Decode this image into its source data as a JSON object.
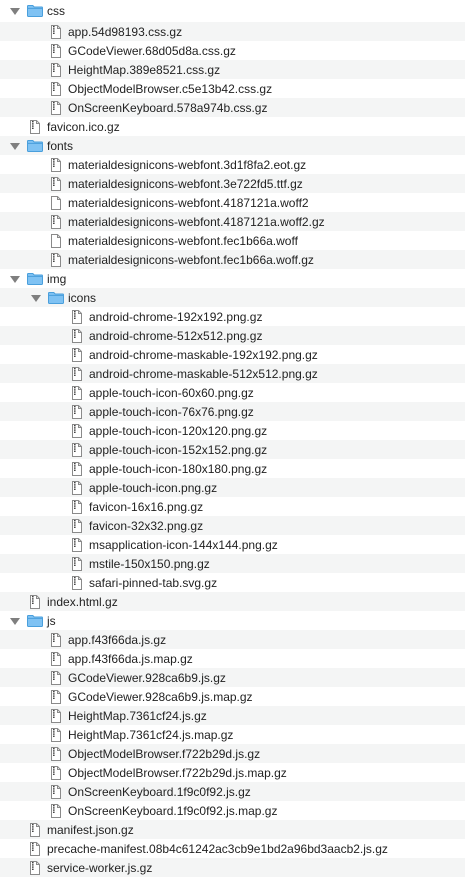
{
  "tree": [
    {
      "depth": 0,
      "type": "folder",
      "expanded": true,
      "name": "css"
    },
    {
      "depth": 1,
      "type": "file",
      "gz": true,
      "name": "app.54d98193.css.gz"
    },
    {
      "depth": 1,
      "type": "file",
      "gz": true,
      "name": "GCodeViewer.68d05d8a.css.gz"
    },
    {
      "depth": 1,
      "type": "file",
      "gz": true,
      "name": "HeightMap.389e8521.css.gz"
    },
    {
      "depth": 1,
      "type": "file",
      "gz": true,
      "name": "ObjectModelBrowser.c5e13b42.css.gz"
    },
    {
      "depth": 1,
      "type": "file",
      "gz": true,
      "name": "OnScreenKeyboard.578a974b.css.gz"
    },
    {
      "depth": 0,
      "type": "file",
      "gz": true,
      "name": "favicon.ico.gz"
    },
    {
      "depth": 0,
      "type": "folder",
      "expanded": true,
      "name": "fonts"
    },
    {
      "depth": 1,
      "type": "file",
      "gz": true,
      "name": "materialdesignicons-webfont.3d1f8fa2.eot.gz"
    },
    {
      "depth": 1,
      "type": "file",
      "gz": true,
      "name": "materialdesignicons-webfont.3e722fd5.ttf.gz"
    },
    {
      "depth": 1,
      "type": "file",
      "gz": false,
      "name": "materialdesignicons-webfont.4187121a.woff2"
    },
    {
      "depth": 1,
      "type": "file",
      "gz": true,
      "name": "materialdesignicons-webfont.4187121a.woff2.gz"
    },
    {
      "depth": 1,
      "type": "file",
      "gz": false,
      "name": "materialdesignicons-webfont.fec1b66a.woff"
    },
    {
      "depth": 1,
      "type": "file",
      "gz": true,
      "name": "materialdesignicons-webfont.fec1b66a.woff.gz"
    },
    {
      "depth": 0,
      "type": "folder",
      "expanded": true,
      "name": "img"
    },
    {
      "depth": 1,
      "type": "folder",
      "expanded": true,
      "name": "icons"
    },
    {
      "depth": 2,
      "type": "file",
      "gz": true,
      "name": "android-chrome-192x192.png.gz"
    },
    {
      "depth": 2,
      "type": "file",
      "gz": true,
      "name": "android-chrome-512x512.png.gz"
    },
    {
      "depth": 2,
      "type": "file",
      "gz": true,
      "name": "android-chrome-maskable-192x192.png.gz"
    },
    {
      "depth": 2,
      "type": "file",
      "gz": true,
      "name": "android-chrome-maskable-512x512.png.gz"
    },
    {
      "depth": 2,
      "type": "file",
      "gz": true,
      "name": "apple-touch-icon-60x60.png.gz"
    },
    {
      "depth": 2,
      "type": "file",
      "gz": true,
      "name": "apple-touch-icon-76x76.png.gz"
    },
    {
      "depth": 2,
      "type": "file",
      "gz": true,
      "name": "apple-touch-icon-120x120.png.gz"
    },
    {
      "depth": 2,
      "type": "file",
      "gz": true,
      "name": "apple-touch-icon-152x152.png.gz"
    },
    {
      "depth": 2,
      "type": "file",
      "gz": true,
      "name": "apple-touch-icon-180x180.png.gz"
    },
    {
      "depth": 2,
      "type": "file",
      "gz": true,
      "name": "apple-touch-icon.png.gz"
    },
    {
      "depth": 2,
      "type": "file",
      "gz": true,
      "name": "favicon-16x16.png.gz"
    },
    {
      "depth": 2,
      "type": "file",
      "gz": true,
      "name": "favicon-32x32.png.gz"
    },
    {
      "depth": 2,
      "type": "file",
      "gz": true,
      "name": "msapplication-icon-144x144.png.gz"
    },
    {
      "depth": 2,
      "type": "file",
      "gz": true,
      "name": "mstile-150x150.png.gz"
    },
    {
      "depth": 2,
      "type": "file",
      "gz": true,
      "name": "safari-pinned-tab.svg.gz"
    },
    {
      "depth": 0,
      "type": "file",
      "gz": true,
      "name": "index.html.gz"
    },
    {
      "depth": 0,
      "type": "folder",
      "expanded": true,
      "name": "js"
    },
    {
      "depth": 1,
      "type": "file",
      "gz": true,
      "name": "app.f43f66da.js.gz"
    },
    {
      "depth": 1,
      "type": "file",
      "gz": true,
      "name": "app.f43f66da.js.map.gz"
    },
    {
      "depth": 1,
      "type": "file",
      "gz": true,
      "name": "GCodeViewer.928ca6b9.js.gz"
    },
    {
      "depth": 1,
      "type": "file",
      "gz": true,
      "name": "GCodeViewer.928ca6b9.js.map.gz"
    },
    {
      "depth": 1,
      "type": "file",
      "gz": true,
      "name": "HeightMap.7361cf24.js.gz"
    },
    {
      "depth": 1,
      "type": "file",
      "gz": true,
      "name": "HeightMap.7361cf24.js.map.gz"
    },
    {
      "depth": 1,
      "type": "file",
      "gz": true,
      "name": "ObjectModelBrowser.f722b29d.js.gz"
    },
    {
      "depth": 1,
      "type": "file",
      "gz": true,
      "name": "ObjectModelBrowser.f722b29d.js.map.gz"
    },
    {
      "depth": 1,
      "type": "file",
      "gz": true,
      "name": "OnScreenKeyboard.1f9c0f92.js.gz"
    },
    {
      "depth": 1,
      "type": "file",
      "gz": true,
      "name": "OnScreenKeyboard.1f9c0f92.js.map.gz"
    },
    {
      "depth": 0,
      "type": "file",
      "gz": true,
      "name": "manifest.json.gz"
    },
    {
      "depth": 0,
      "type": "file",
      "gz": true,
      "name": "precache-manifest.08b4c61242ac3cb9e1bd2a96bd3aacb2.js.gz"
    },
    {
      "depth": 0,
      "type": "file",
      "gz": true,
      "name": "service-worker.js.gz"
    }
  ],
  "colors": {
    "folder": "#5aaee9",
    "folder_tab": "#4a9fdc",
    "row_alt": "#f4f5f5",
    "triangle": "#7f7f7f",
    "text": "#222222"
  }
}
